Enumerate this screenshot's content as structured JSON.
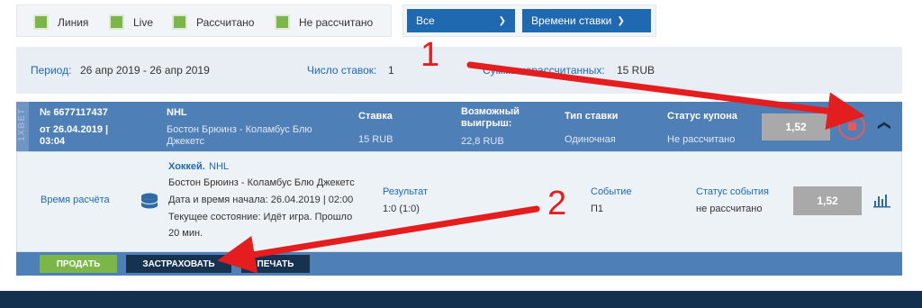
{
  "filters": {
    "checkboxes": [
      {
        "label": "Линия"
      },
      {
        "label": "Live"
      },
      {
        "label": "Рассчитано"
      },
      {
        "label": "Не рассчитано"
      }
    ],
    "dropdown_status": "Все",
    "dropdown_sort": "Времени ставки"
  },
  "period": {
    "label": "Период:",
    "value": "26 апр 2019 - 26 апр 2019",
    "count_label": "Число ставок:",
    "count_value": "1",
    "unsettled_label": "Сумма нерассчитанных:",
    "unsettled_value": "15 RUB"
  },
  "coupon": {
    "logo": "1XBET",
    "number": "№ 6677117437",
    "date_line1": "от 26.04.2019 |",
    "date_line2": "03:04",
    "league": "NHL",
    "teams_line1": "Бостон Брюинз - Коламбус Блю",
    "teams_line2": "Джекетс",
    "stake_label": "Ставка",
    "stake_value": "15 RUB",
    "win_label_1": "Возможный",
    "win_label_2": "выигрыш:",
    "win_value": "22,8 RUB",
    "type_label": "Тип ставки",
    "type_value": "Одиночная",
    "status_label": "Статус купона",
    "status_value": "Не рассчитано",
    "coefficient": "1,52"
  },
  "detail": {
    "calc_time": "Время расчёта",
    "sport": "Хоккей.",
    "league": "NHL",
    "teams": "Бостон Брюинз - Коламбус Блю Джекетс",
    "start": "Дата и время начала: 26.04.2019 | 02:00",
    "state_line1": "Текущее состояние: Идёт игра. Прошло",
    "state_line2": "20 мин.",
    "result_label": "Результат",
    "result_value": "1:0 (1:0)",
    "event_label": "Событие",
    "event_value": "П1",
    "event_status_label": "Статус события",
    "event_status_value": "не рассчитано",
    "coefficient": "1,52"
  },
  "actions": {
    "sell": "ПРОДАТЬ",
    "insure": "ЗАСТРАХОВАТЬ",
    "print": "ПЕЧАТЬ"
  },
  "annotations": {
    "one": "1",
    "two": "2"
  },
  "colors": {
    "accent_blue": "#1f69b0",
    "coupon_blue": "#4f7fb7",
    "green": "#7ab648",
    "arrow_red": "#e41e1e",
    "footer": "#13304f"
  }
}
